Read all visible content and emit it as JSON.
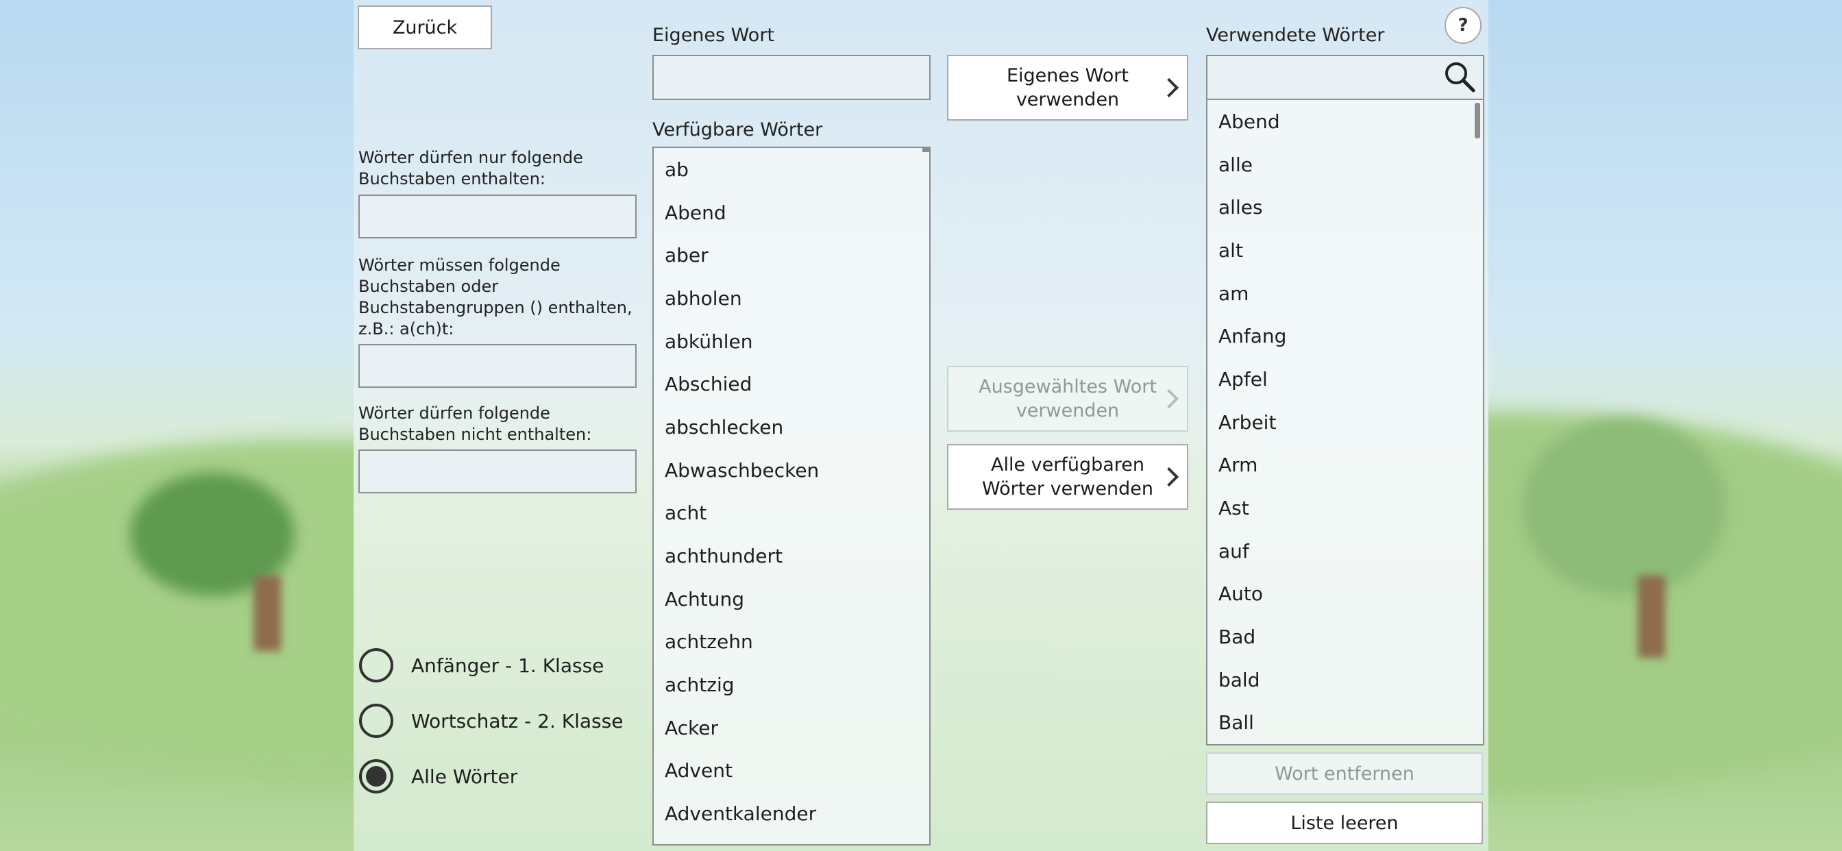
{
  "header": {
    "back_label": "Zurück",
    "help_label": "?"
  },
  "custom_word": {
    "label": "Eigenes Wort",
    "value": "",
    "use_button": "Eigenes Wort\nverwenden"
  },
  "filters": {
    "only_letters_label": "Wörter dürfen nur folgende Buchstaben enthalten:",
    "only_letters_value": "",
    "must_contain_label": "Wörter müssen folgende Buchstaben oder Buchstabengruppen () enthalten, z.B.: a(ch)t:",
    "must_contain_value": "",
    "not_contain_label": "Wörter dürfen folgende Buchstaben nicht enthalten:",
    "not_contain_value": ""
  },
  "levels": [
    {
      "label": "Anfänger - 1. Klasse",
      "selected": false
    },
    {
      "label": "Wortschatz - 2. Klasse",
      "selected": false
    },
    {
      "label": "Alle Wörter",
      "selected": true
    }
  ],
  "available": {
    "label": "Verfügbare Wörter",
    "items": [
      "ab",
      "Abend",
      "aber",
      "abholen",
      "abkühlen",
      "Abschied",
      "abschlecken",
      "Abwaschbecken",
      "acht",
      "achthundert",
      "Achtung",
      "achtzehn",
      "achtzig",
      "Acker",
      "Advent",
      "Adventkalender"
    ]
  },
  "actions": {
    "use_selected": "Ausgewähltes Wort\nverwenden",
    "use_all": "Alle verfügbaren\nWörter verwenden"
  },
  "used": {
    "label": "Verwendete Wörter",
    "search_value": "",
    "items": [
      "Abend",
      "alle",
      "alles",
      "alt",
      "am",
      "Anfang",
      "Apfel",
      "Arbeit",
      "Arm",
      "Ast",
      "auf",
      "Auto",
      "Bad",
      "bald",
      "Ball"
    ],
    "remove_label": "Wort entfernen",
    "clear_label": "Liste leeren"
  },
  "colors": {
    "panel": "#e3eff4",
    "border": "#8a8f92",
    "disabled_text": "#8e9a98"
  }
}
